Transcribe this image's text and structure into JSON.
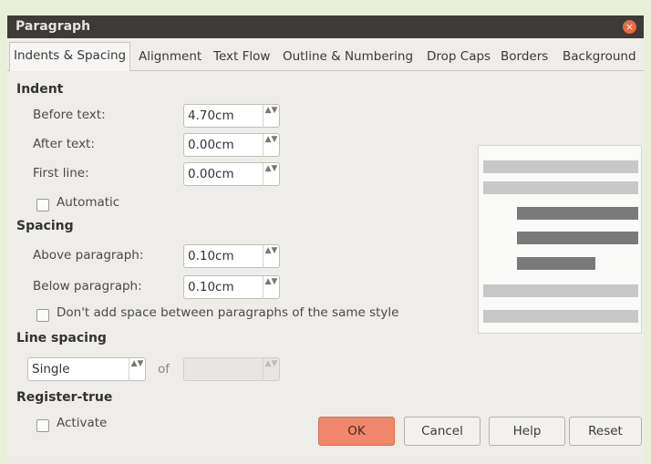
{
  "window": {
    "title": "Paragraph",
    "close_glyph": "×"
  },
  "tabs": [
    {
      "label": "Indents & Spacing",
      "active": true
    },
    {
      "label": "Alignment"
    },
    {
      "label": "Text Flow"
    },
    {
      "label": "Outline & Numbering"
    },
    {
      "label": "Drop Caps"
    },
    {
      "label": "Borders"
    },
    {
      "label": "Background"
    }
  ],
  "indent": {
    "heading": "Indent",
    "before_text": {
      "label": "Before text:",
      "value": "4.70cm"
    },
    "after_text": {
      "label": "After text:",
      "value": "0.00cm"
    },
    "first_line": {
      "label": "First line:",
      "value": "0.00cm"
    },
    "automatic": {
      "label": "Automatic",
      "checked": false
    }
  },
  "spacing": {
    "heading": "Spacing",
    "above": {
      "label": "Above paragraph:",
      "value": "0.10cm"
    },
    "below": {
      "label": "Below paragraph:",
      "value": "0.10cm"
    },
    "no_space": {
      "label": "Don't add space between paragraphs of the same style",
      "checked": false
    }
  },
  "line_spacing": {
    "heading": "Line spacing",
    "selected": "Single",
    "of_label": "of",
    "of_value": ""
  },
  "register_true": {
    "heading": "Register-true",
    "activate": {
      "label": "Activate",
      "checked": false
    }
  },
  "buttons": {
    "ok": "OK",
    "cancel": "Cancel",
    "help": "Help",
    "reset": "Reset"
  },
  "icons": {
    "spin_arrows": "▲▼",
    "close": "close-icon"
  },
  "colors": {
    "titlebar": "#3c3b37",
    "ok_button": "#f0876a",
    "preview_light_bar": "#c8c8c8",
    "preview_dark_bar": "#7a7a7a"
  }
}
